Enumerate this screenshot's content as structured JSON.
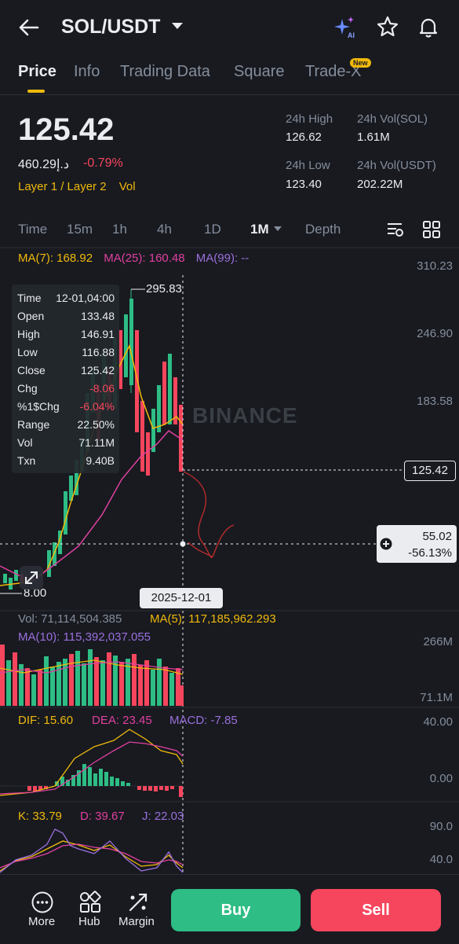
{
  "header": {
    "pair": "SOL/USDT",
    "icons": [
      "back-arrow-icon",
      "ai-sparkle-icon",
      "star-icon",
      "bell-icon"
    ],
    "ai_label": "AI"
  },
  "tabs": {
    "items": [
      "Price",
      "Info",
      "Trading Data",
      "Square",
      "Trade-X"
    ],
    "active": "Price",
    "new_badge": "New"
  },
  "ticker": {
    "last_price": "125.42",
    "fiat_price": "460.29د.إ",
    "change_pct": "-0.79%",
    "tag_1": "Layer 1 / Layer 2",
    "tag_2": "Vol",
    "high_label": "24h High",
    "high_value": "126.62",
    "low_label": "24h Low",
    "low_value": "123.40",
    "vol_base_label": "24h Vol(SOL)",
    "vol_base_value": "1.61M",
    "vol_quote_label": "24h Vol(USDT)",
    "vol_quote_value": "202.22M"
  },
  "timeframes": {
    "items": [
      "Time",
      "15m",
      "1h",
      "4h",
      "1D",
      "1M",
      "Depth"
    ],
    "active": "1M"
  },
  "ma": {
    "ma7": "MA(7): 168.92",
    "ma25": "MA(25): 160.48",
    "ma99": "MA(99): --"
  },
  "price_axis": [
    "310.23",
    "246.90",
    "183.58"
  ],
  "watermark": "BINANCE",
  "chart_labels": {
    "high_marker": "295.83",
    "low_marker": "8.00",
    "current_price": "125.42",
    "cross_price": "55.02",
    "cross_pct": "-56.13%",
    "cross_date": "2025-12-01"
  },
  "info_box": {
    "rows": [
      {
        "label": "Time",
        "value": "12-01,04:00"
      },
      {
        "label": "Open",
        "value": "133.48"
      },
      {
        "label": "High",
        "value": "146.91"
      },
      {
        "label": "Low",
        "value": "116.88"
      },
      {
        "label": "Close",
        "value": "125.42"
      },
      {
        "label": "Chg",
        "value": "-8.06"
      },
      {
        "label": "%1$Chg",
        "value": "-6.04%"
      },
      {
        "label": "Range",
        "value": "22.50%"
      },
      {
        "label": "Vol",
        "value": "71.11M"
      },
      {
        "label": "Txn",
        "value": "9.40B"
      }
    ]
  },
  "volume": {
    "vol": "Vol: 71,114,504.385",
    "ma5": "MA(5): 117,185,962.293",
    "ma10": "MA(10): 115,392,037.055",
    "axis_top": "266M",
    "axis_bottom": "71.1M"
  },
  "macd": {
    "dif": "DIF: 15.60",
    "dea": "DEA: 23.45",
    "macd": "MACD: -7.85",
    "axis_top": "40.00",
    "axis_mid": "0.00"
  },
  "kdj": {
    "k": "K: 33.79",
    "d": "D: 39.67",
    "j": "J: 22.03",
    "axis_top": "90.0",
    "axis_mid": "40.0"
  },
  "bottom_bar": {
    "more": "More",
    "hub": "Hub",
    "margin": "Margin",
    "buy": "Buy",
    "sell": "Sell"
  },
  "colors": {
    "up": "#2ebd85",
    "down": "#f6465d",
    "accent": "#f0b90b",
    "ma7": "#f0b90b",
    "ma25": "#e040a0",
    "ma99": "#9b6fdc"
  }
}
